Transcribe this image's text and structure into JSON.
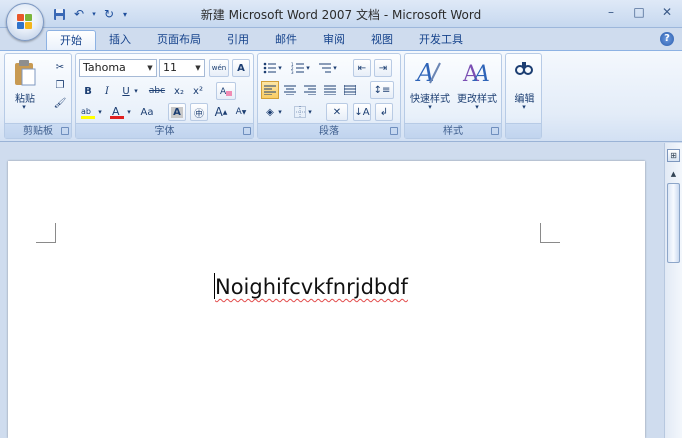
{
  "title_bar": {
    "title": "新建 Microsoft Word 2007 文档 - Microsoft Word",
    "qat": {
      "save_icon": "save-icon",
      "undo_icon": "undo-icon",
      "redo_icon": "redo-icon",
      "more_icon": "chevron-down-icon"
    },
    "window_buttons": {
      "minimize": "–",
      "maximize": "□",
      "close": "✕"
    }
  },
  "tabs": [
    "开始",
    "插入",
    "页面布局",
    "引用",
    "邮件",
    "审阅",
    "视图",
    "开发工具"
  ],
  "active_tab": "开始",
  "help": "?",
  "groups": {
    "clipboard": {
      "label": "剪贴板",
      "paste_label": "粘贴"
    },
    "font": {
      "label": "字体",
      "font_name": "Tahoma",
      "font_size": "11",
      "bold": "B",
      "italic": "I",
      "underline": "U",
      "strikethrough": "abc",
      "subscript": "x₂",
      "superscript": "x²",
      "change_case": "Aa",
      "grow": "A",
      "shrink": "A",
      "char_border": "A",
      "wen": "wén"
    },
    "paragraph": {
      "label": "段落"
    },
    "styles": {
      "label": "样式",
      "quick_styles": "快速样式",
      "change_styles": "更改样式"
    },
    "editing": {
      "label": "编辑"
    }
  },
  "document": {
    "text": "Noighifcvkfnrjdbdf"
  }
}
